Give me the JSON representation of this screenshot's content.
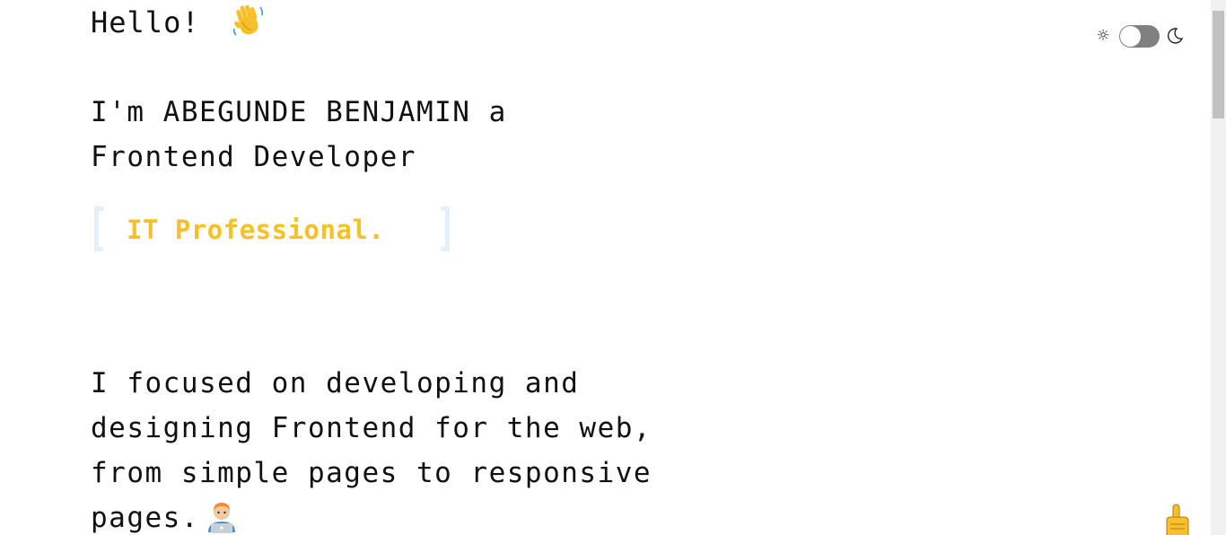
{
  "greeting": {
    "text": "Hello!",
    "emoji_icon": "waving-hand-icon"
  },
  "intro": {
    "text": "I'm ABEGUNDE BENJAMIN a Frontend Developer"
  },
  "typed_role": {
    "text": "IT Professional.",
    "color": "#f6c026"
  },
  "description": {
    "text": "I focused on developing and designing Frontend for the web, from simple pages to responsive pages.",
    "emoji_icon": "technologist-icon"
  },
  "theme_toggle": {
    "light_icon": "☼",
    "dark_icon": "moon-icon",
    "state": "light"
  },
  "scroll_top": {
    "icon": "pointing-up-icon"
  },
  "colors": {
    "text": "#111111",
    "accent": "#f6c026",
    "bracket": "#e3f0fb",
    "toggle": "#808080"
  }
}
